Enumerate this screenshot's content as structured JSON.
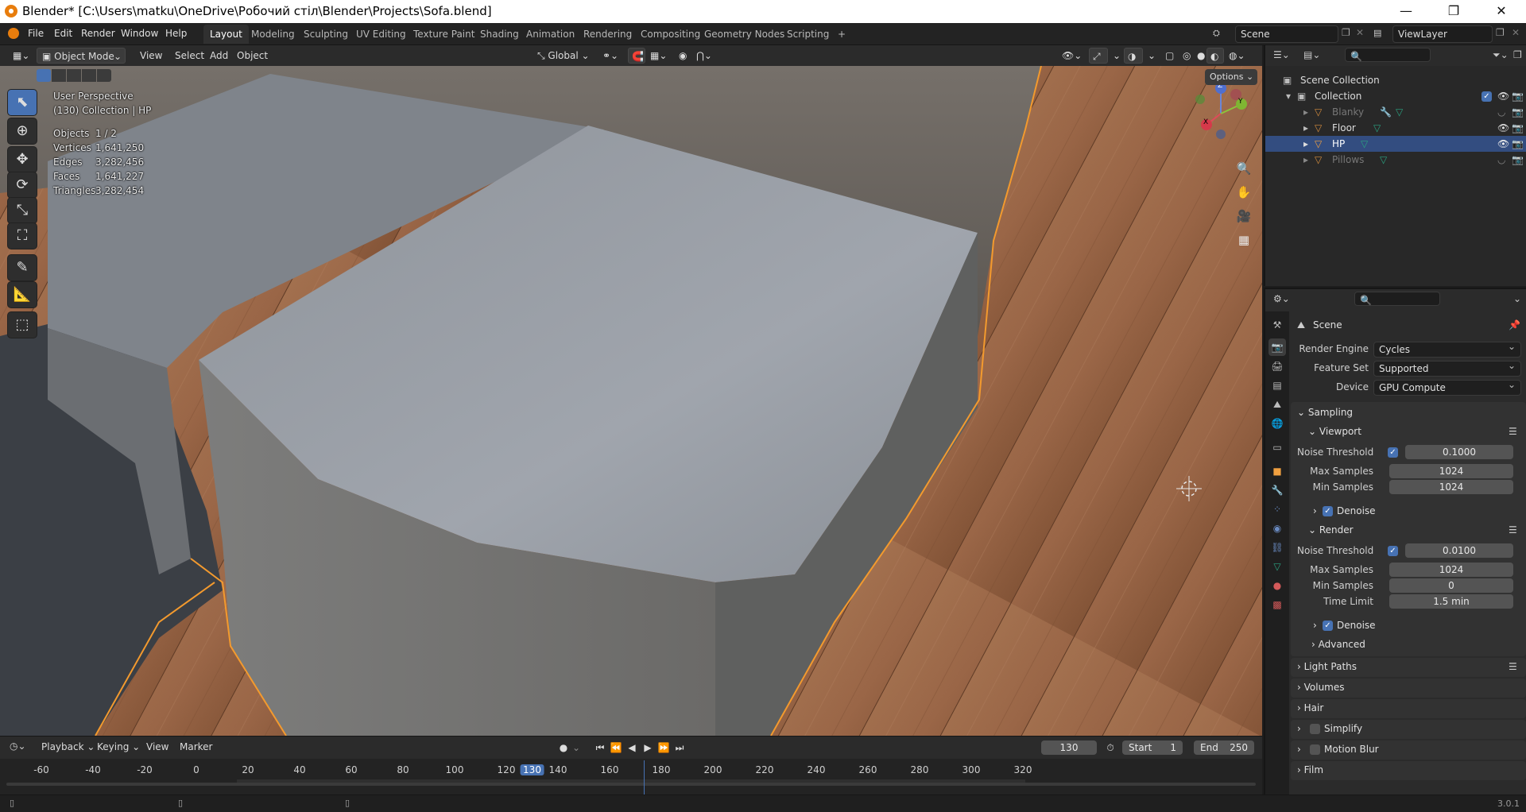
{
  "window": {
    "title": "Blender* [C:\\Users\\matku\\OneDrive\\Робочий стіл\\Blender\\Projects\\Sofa.blend]",
    "minimize": "—",
    "maximize": "❐",
    "close": "✕"
  },
  "menus": [
    "File",
    "Edit",
    "Render",
    "Window",
    "Help"
  ],
  "workspaces": [
    "Layout",
    "Modeling",
    "Sculpting",
    "UV Editing",
    "Texture Paint",
    "Shading",
    "Animation",
    "Rendering",
    "Compositing",
    "Geometry Nodes",
    "Scripting",
    "+"
  ],
  "active_workspace": "Layout",
  "scene_field": "Scene",
  "viewlayer_field": "ViewLayer",
  "viewport_header": {
    "mode": "Object Mode",
    "menus": [
      "View",
      "Select",
      "Add",
      "Object"
    ],
    "orientation": "Global",
    "options": "Options"
  },
  "overlay": {
    "view_name": "User Perspective",
    "collection": "(130) Collection | HP",
    "stats": [
      {
        "label": "Objects",
        "value": "1 / 2"
      },
      {
        "label": "Vertices",
        "value": "1,641,250"
      },
      {
        "label": "Edges",
        "value": "3,282,456"
      },
      {
        "label": "Faces",
        "value": "1,641,227"
      },
      {
        "label": "Triangles",
        "value": "3,282,454"
      }
    ]
  },
  "gizmo_axes": {
    "x": "X",
    "y": "Y",
    "z": "Z"
  },
  "outliner": {
    "root": "Scene Collection",
    "collection": "Collection",
    "items": [
      {
        "name": "Blanky",
        "visible": false
      },
      {
        "name": "Floor",
        "visible": true
      },
      {
        "name": "HP",
        "visible": true,
        "selected": true
      },
      {
        "name": "Pillows",
        "visible": false
      }
    ]
  },
  "properties": {
    "context": "Scene",
    "render_engine_label": "Render Engine",
    "render_engine": "Cycles",
    "feature_set_label": "Feature Set",
    "feature_set": "Supported",
    "device_label": "Device",
    "device": "GPU Compute",
    "sampling": "Sampling",
    "viewport": {
      "title": "Viewport",
      "noise_threshold_label": "Noise Threshold",
      "noise_threshold": "0.1000",
      "max_samples_label": "Max Samples",
      "max_samples": "1024",
      "min_samples_label": "Min Samples",
      "min_samples": "1024",
      "denoise": "Denoise"
    },
    "render": {
      "title": "Render",
      "noise_threshold_label": "Noise Threshold",
      "noise_threshold": "0.0100",
      "max_samples_label": "Max Samples",
      "max_samples": "1024",
      "min_samples_label": "Min Samples",
      "min_samples": "0",
      "time_limit_label": "Time Limit",
      "time_limit": "1.5 min",
      "denoise": "Denoise"
    },
    "advanced": "Advanced",
    "sections": [
      "Light Paths",
      "Volumes",
      "Hair",
      "Simplify",
      "Motion Blur",
      "Film"
    ]
  },
  "timeline": {
    "menus": [
      "Playback",
      "Keying",
      "View",
      "Marker"
    ],
    "current_frame": "130",
    "start_label": "Start",
    "start": "1",
    "end_label": "End",
    "end": "250",
    "ticks": [
      "-60",
      "-40",
      "-20",
      "0",
      "20",
      "40",
      "60",
      "80",
      "100",
      "120",
      "130",
      "140",
      "160",
      "180",
      "200",
      "220",
      "240",
      "260",
      "280",
      "300",
      "320"
    ]
  },
  "status": {
    "version": "3.0.1"
  },
  "colors": {
    "accent": "#4772b3",
    "selection_outline": "#f39a2e",
    "title_bar": "#ffffff"
  }
}
